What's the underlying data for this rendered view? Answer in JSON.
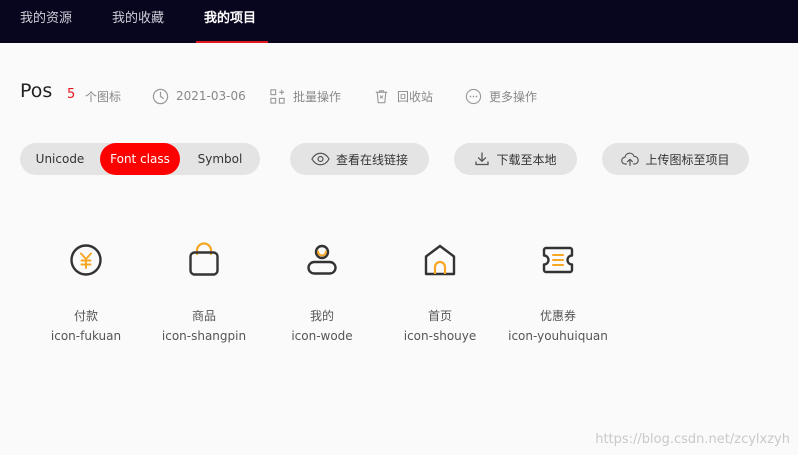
{
  "nav": {
    "tabs": [
      {
        "label": "我的资源"
      },
      {
        "label": "我的收藏"
      },
      {
        "label": "我的项目"
      }
    ]
  },
  "project": {
    "title": "Pos",
    "icon_count": "5",
    "icon_count_unit": "个图标",
    "date": "2021-03-06",
    "batch_label": "批量操作",
    "recycle_label": "回收站",
    "more_label": "更多操作"
  },
  "toolbar": {
    "tabs": [
      {
        "label": "Unicode"
      },
      {
        "label": "Font class"
      },
      {
        "label": "Symbol"
      }
    ],
    "view_link_label": "查看在线链接",
    "download_label": "下载至本地",
    "upload_label": "上传图标至项目"
  },
  "icons": [
    {
      "title": "付款",
      "class": "icon-fukuan",
      "glyph": "payment-icon"
    },
    {
      "title": "商品",
      "class": "icon-shangpin",
      "glyph": "shopping-bag-icon"
    },
    {
      "title": "我的",
      "class": "icon-wode",
      "glyph": "user-icon"
    },
    {
      "title": "首页",
      "class": "icon-shouye",
      "glyph": "home-icon"
    },
    {
      "title": "优惠券",
      "class": "icon-youhuiquan",
      "glyph": "coupon-icon"
    }
  ],
  "colors": {
    "nav_bg": "#08051e",
    "accent_red": "#ff0000",
    "icon_stroke": "#333333",
    "icon_accent": "#f5a623"
  },
  "watermark": "https://blog.csdn.net/zcylxzyh"
}
